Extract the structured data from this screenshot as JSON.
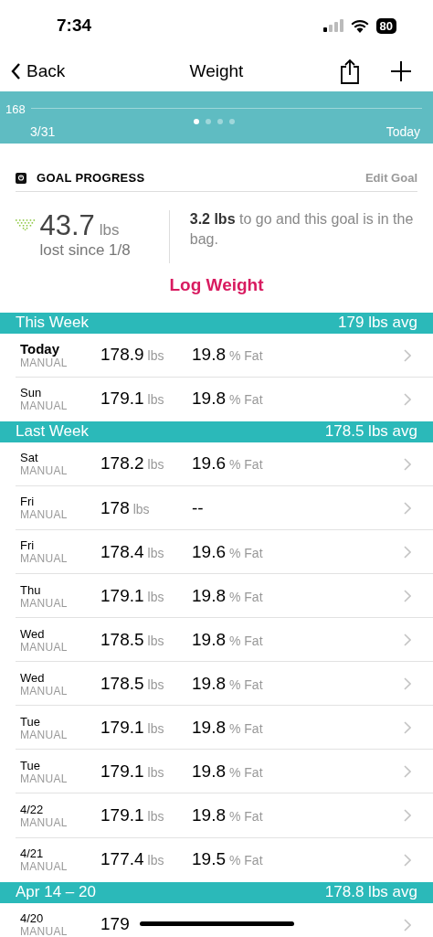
{
  "status_bar": {
    "time": "7:34",
    "battery": "80"
  },
  "nav": {
    "back": "Back",
    "title": "Weight"
  },
  "chart": {
    "y_label": "168",
    "start": "3/31",
    "end": "Today",
    "pages": [
      {
        "selected": true
      },
      {
        "selected": false
      },
      {
        "selected": false
      },
      {
        "selected": false
      }
    ]
  },
  "goal": {
    "heading": "GOAL PROGRESS",
    "edit": "Edit Goal",
    "amount": "43.7",
    "unit": "lbs",
    "since": "lost since 1/8",
    "message": "**3.2 lbs** to go and this goal is in the bag."
  },
  "log_button": "Log Weight",
  "sections": [
    {
      "title": "This Week",
      "avg": "179 lbs avg",
      "rows": [
        {
          "day": "Today",
          "highlighted": true,
          "source": "MANUAL",
          "weight": "178.9",
          "weight_unit": "lbs",
          "fat": "19.8",
          "fat_unit": "% Fat"
        },
        {
          "day": "Sun",
          "highlighted": false,
          "source": "MANUAL",
          "weight": "179.1",
          "weight_unit": "lbs",
          "fat": "19.8",
          "fat_unit": "% Fat"
        }
      ]
    },
    {
      "title": "Last Week",
      "avg": "178.5 lbs avg",
      "rows": [
        {
          "day": "Sat",
          "highlighted": false,
          "source": "MANUAL",
          "weight": "178.2",
          "weight_unit": "lbs",
          "fat": "19.6",
          "fat_unit": "% Fat"
        },
        {
          "day": "Fri",
          "highlighted": false,
          "source": "MANUAL",
          "weight": "178",
          "weight_unit": "lbs",
          "fat": "--"
        },
        {
          "day": "Fri",
          "highlighted": false,
          "source": "MANUAL",
          "weight": "178.4",
          "weight_unit": "lbs",
          "fat": "19.6",
          "fat_unit": "% Fat"
        },
        {
          "day": "Thu",
          "highlighted": false,
          "source": "MANUAL",
          "weight": "179.1",
          "weight_unit": "lbs",
          "fat": "19.8",
          "fat_unit": "% Fat"
        },
        {
          "day": "Wed",
          "highlighted": false,
          "source": "MANUAL",
          "weight": "178.5",
          "weight_unit": "lbs",
          "fat": "19.8",
          "fat_unit": "% Fat"
        },
        {
          "day": "Wed",
          "highlighted": false,
          "source": "MANUAL",
          "weight": "178.5",
          "weight_unit": "lbs",
          "fat": "19.8",
          "fat_unit": "% Fat"
        },
        {
          "day": "Tue",
          "highlighted": false,
          "source": "MANUAL",
          "weight": "179.1",
          "weight_unit": "lbs",
          "fat": "19.8",
          "fat_unit": "% Fat"
        },
        {
          "day": "Tue",
          "highlighted": false,
          "source": "MANUAL",
          "weight": "179.1",
          "weight_unit": "lbs",
          "fat": "19.8",
          "fat_unit": "% Fat"
        },
        {
          "day": "4/22",
          "highlighted": false,
          "source": "MANUAL",
          "weight": "179.1",
          "weight_unit": "lbs",
          "fat": "19.8",
          "fat_unit": "% Fat"
        },
        {
          "day": "4/21",
          "highlighted": false,
          "source": "MANUAL",
          "weight": "177.4",
          "weight_unit": "lbs",
          "fat": "19.5",
          "fat_unit": "% Fat"
        }
      ]
    },
    {
      "title": "Apr 14 – 20",
      "avg": "178.8 lbs avg",
      "rows": [
        {
          "day": "4/20",
          "highlighted": false,
          "source": "MANUAL",
          "weight": "179"
        }
      ]
    }
  ]
}
